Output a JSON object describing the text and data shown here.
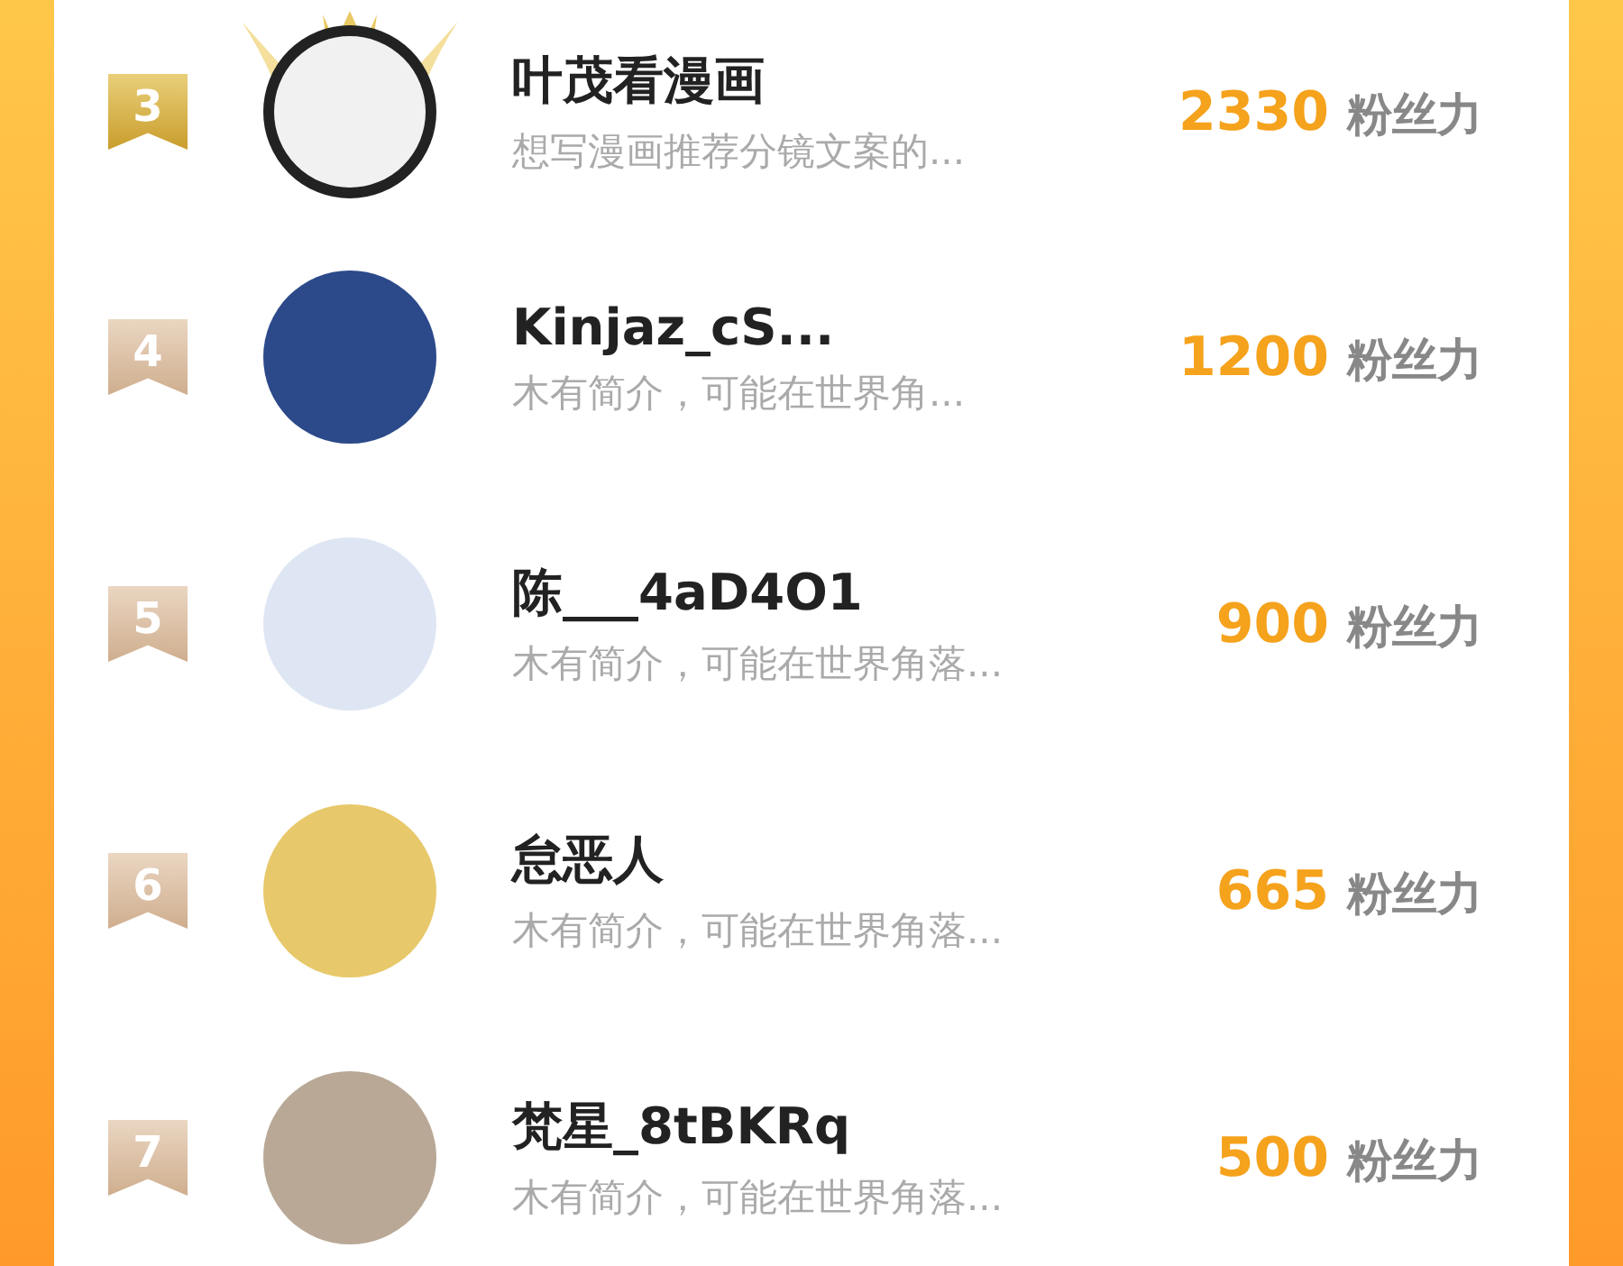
{
  "ranking": [
    {
      "rank": "3",
      "kind": "crowned",
      "name": "叶茂看漫画",
      "bio": "想写漫画推荐分镜文案的...",
      "score": "2330",
      "unit": "粉丝力"
    },
    {
      "rank": "4",
      "kind": "plain",
      "name": "Kinjaz_cS...",
      "bio": "木有简介，可能在世界角...",
      "score": "1200",
      "unit": "粉丝力"
    },
    {
      "rank": "5",
      "kind": "plain",
      "name": "陈___4aD4O1",
      "bio": "木有简介，可能在世界角落...",
      "score": "900",
      "unit": "粉丝力"
    },
    {
      "rank": "6",
      "kind": "plain",
      "name": "怠恶人",
      "bio": "木有简介，可能在世界角落...",
      "score": "665",
      "unit": "粉丝力"
    },
    {
      "rank": "7",
      "kind": "plain",
      "name": "梵星_8tBKRq",
      "bio": "木有简介，可能在世界角落...",
      "score": "500",
      "unit": "粉丝力"
    }
  ]
}
